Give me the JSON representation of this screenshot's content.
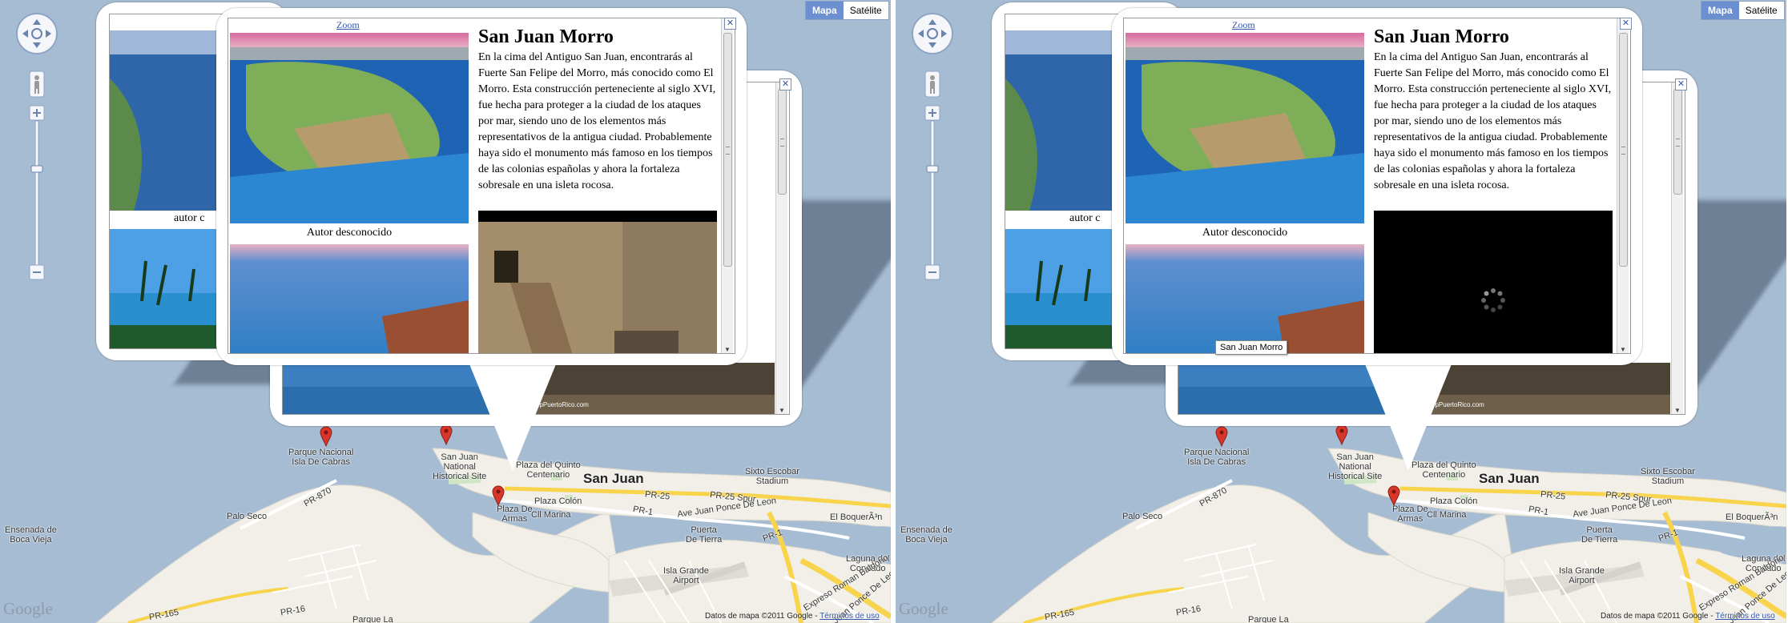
{
  "map_type": {
    "map_label": "Mapa",
    "satellite_label": "Satélite"
  },
  "popup": {
    "zoom_label": "Zoom",
    "title": "San Juan Morro",
    "description": "En la cima del Antiguo San Juan, encontrarás al Fuerte San Felipe del Morro, más conocido como El Morro. Esta construcción perteneciente al siglo XVI, fue hecha para proteger a la ciudad de los ataques por mar, siendo uno de los elementos más representativos de la antigua ciudad. Probablemente haya sido el monumento más famoso en los tiempos de las colonias españolas y ahora la fortaleza sobresale en una isleta rocosa.",
    "photo_caption": "Autor desconocido",
    "close_glyph": "✕"
  },
  "back_popup": {
    "caption_partial": "autor c",
    "watermark": "TopPuertoRico.com"
  },
  "tooltip": "San Juan Morro",
  "map_labels": {
    "parque_nacional": "Parque Nacional\nIsla De Cabras",
    "national_site": "San Juan\nNational\nHistorical Site",
    "plaza_quinto": "Plaza del Quinto\nCentenario",
    "sixto": "Sixto Escobar\nStadium",
    "san_juan": "San Juan",
    "plaza_colon": "Plaza Colón",
    "plaza_armas": "Plaza De\nArmas",
    "marina": "Cll Marina",
    "palo_seco": "Palo Seco",
    "ensenada": "Ensenada de\nBoca Vieja",
    "puerta": "Puerta\nDe Tierra",
    "boqueron": "El BoquerÃ³n",
    "laguna": "Laguna del\nCondado",
    "isla_grande": "Isla Grande\nAirport",
    "pr870": "PR-870",
    "pr25spur": "PR-25 Spur",
    "pr25": "PR-25",
    "pr1a": "PR-1",
    "pr1b": "PR-1",
    "ponce": "Ave Juan Ponce De Leon",
    "ponce2": "Ave Juan Ponce De Leon",
    "expreso": "Expreso Roman Baldorio",
    "pr165": "PR-165",
    "pr165b": "PR-16",
    "parque_la": "Parque La"
  },
  "copyright": {
    "text": "Datos de mapa ©2011 Google - ",
    "link": "Términos de uso"
  },
  "logo": "Google",
  "colors": {
    "water": "#a6bcd3",
    "land": "#f1efe8",
    "highway": "#f8d44c",
    "marker": "#d9362b",
    "maptype_active": "#6c8fcf"
  }
}
